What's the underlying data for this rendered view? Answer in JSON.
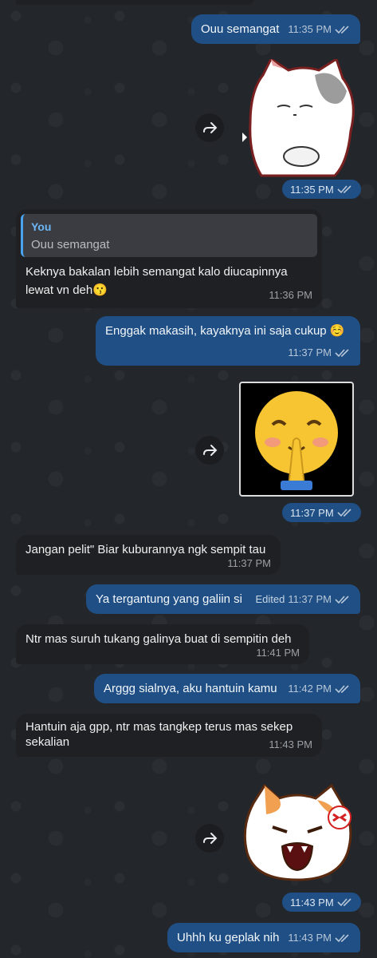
{
  "messages": [
    {
      "id": "m1",
      "text": "Ouu semangat",
      "time": "11:35 PM"
    },
    {
      "id": "sticker1_time",
      "time": "11:35 PM"
    },
    {
      "id": "m3",
      "reply_author": "You",
      "reply_text": "Ouu semangat",
      "text_line1": "Keknya bakalan lebih semangat kalo diucapinnya",
      "text_line2": "lewat vn deh😗",
      "time": "11:36 PM"
    },
    {
      "id": "m4",
      "text": "Enggak makasih, kayaknya ini saja cukup ☺️",
      "time": "11:37 PM"
    },
    {
      "id": "emoji_time",
      "time": "11:37 PM",
      "emoji": "🙏"
    },
    {
      "id": "m6",
      "text": "Jangan pelit\" Biar kuburannya ngk sempit tau",
      "time": "11:37 PM"
    },
    {
      "id": "m7",
      "text": "Ya tergantung yang galiin si",
      "edited": "Edited",
      "time": "11:37 PM"
    },
    {
      "id": "m8",
      "text": "Ntr mas suruh tukang galinya buat di sempitin deh",
      "time": "11:41 PM"
    },
    {
      "id": "m9",
      "text": "Arggg sialnya, aku hantuin kamu",
      "time": "11:42 PM"
    },
    {
      "id": "m10",
      "text_line1": "Hantuin aja gpp, ntr mas tangkep terus mas sekep",
      "text_line2": "sekalian",
      "time": "11:43 PM"
    },
    {
      "id": "sticker2_time",
      "time": "11:43 PM"
    },
    {
      "id": "m12",
      "text": "Uhhh ku geplak nih",
      "time": "11:43 PM"
    }
  ],
  "icons": {
    "forward": "forward-arrow-icon",
    "read": "double-check-icon"
  },
  "colors": {
    "outgoing": "#1f4f84",
    "incoming": "#1f2023",
    "background": "#23262b",
    "accent": "#4aa3f0"
  }
}
